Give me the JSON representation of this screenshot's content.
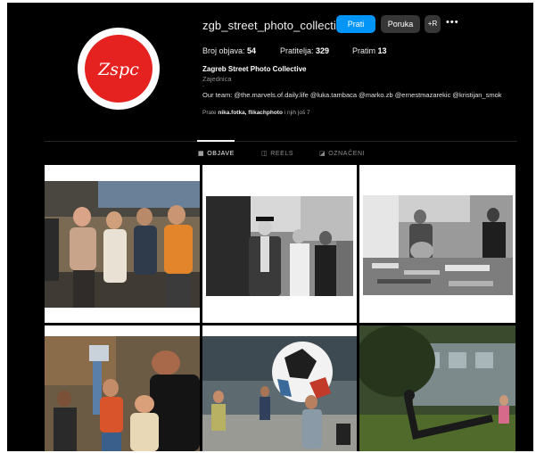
{
  "profile": {
    "username": "zgb_street_photo_collective",
    "full_name": "Zagreb Street Photo Collective",
    "category": "Zajednica",
    "dot": ".",
    "bio": "Our team: @the.marvels.of.daily.life @luka.tambaca @marko.zb @ernestmazarekic @kristijan_smok",
    "followed_by_prefix": "Prate ",
    "followed_by_names": "nika.fotka, flikachphoto",
    "followed_by_suffix": " i njih još 7",
    "avatar_text": "Zspc"
  },
  "buttons": {
    "follow": "Prati",
    "message": "Poruka",
    "add_user": "+R",
    "more": "•••"
  },
  "stats": {
    "posts_label": "Broj objava: ",
    "posts_value": "54",
    "followers_label": "Pratitelja: ",
    "followers_value": "329",
    "following_label": "Pratim ",
    "following_value": "13"
  },
  "tabs": [
    {
      "label": "OBJAVE",
      "icon": "grid-icon",
      "active": true
    },
    {
      "label": "REELS",
      "icon": "reels-icon",
      "active": false
    },
    {
      "label": "OZNAČENI",
      "icon": "tagged-icon",
      "active": false
    }
  ],
  "tab_icons": [
    "▦",
    "◫",
    "◪"
  ],
  "colors": {
    "background": "#000000",
    "follow_button": "#0095f6",
    "secondary_button": "#363636",
    "avatar_red": "#e52220"
  },
  "posts": [
    {
      "description_icon": "photo-crowd-sunglasses"
    },
    {
      "description_icon": "photo-man-in-hat"
    },
    {
      "description_icon": "photo-market-stall"
    },
    {
      "description_icon": "photo-street-boys"
    },
    {
      "description_icon": "photo-giant-football"
    },
    {
      "description_icon": "photo-park-anchor"
    }
  ]
}
